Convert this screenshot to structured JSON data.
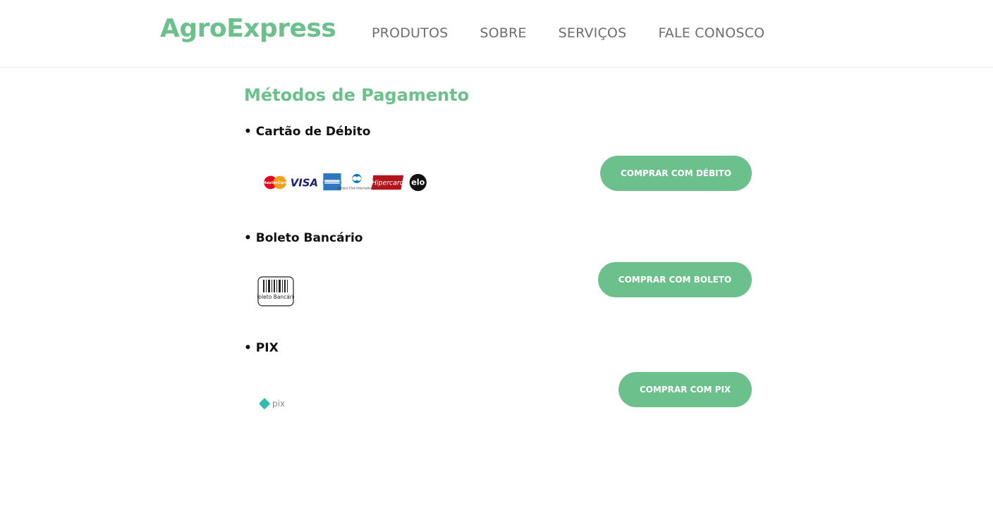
{
  "header": {
    "logo": "AgroExpress",
    "nav": [
      "PRODUTOS",
      "SOBRE",
      "SERVIÇOS",
      "FALE CONOSCO"
    ]
  },
  "main": {
    "title": "Métodos de Pagamento",
    "methods": [
      {
        "title": "• Cartão de Débito",
        "button": "COMPRAR COM DÉBITO",
        "brands": {
          "mastercard": "MasterCard",
          "visa": "VISA",
          "amex": "AMERICAN EXPRESS",
          "diners": "Diners Club International",
          "hipercard": "Hipercard",
          "elo": "elo"
        }
      },
      {
        "title": "• Boleto Bancário",
        "button": "COMPRAR COM BOLETO",
        "icon_text": "Boleto Bancário"
      },
      {
        "title": "• PIX",
        "button": "COMPRAR COM PIX",
        "icon_text": "pix"
      }
    ]
  },
  "colors": {
    "accent": "#6cc08c",
    "nav_text": "#6e6e6e",
    "pix": "#32bcad",
    "hipercard": "#b3131b"
  }
}
